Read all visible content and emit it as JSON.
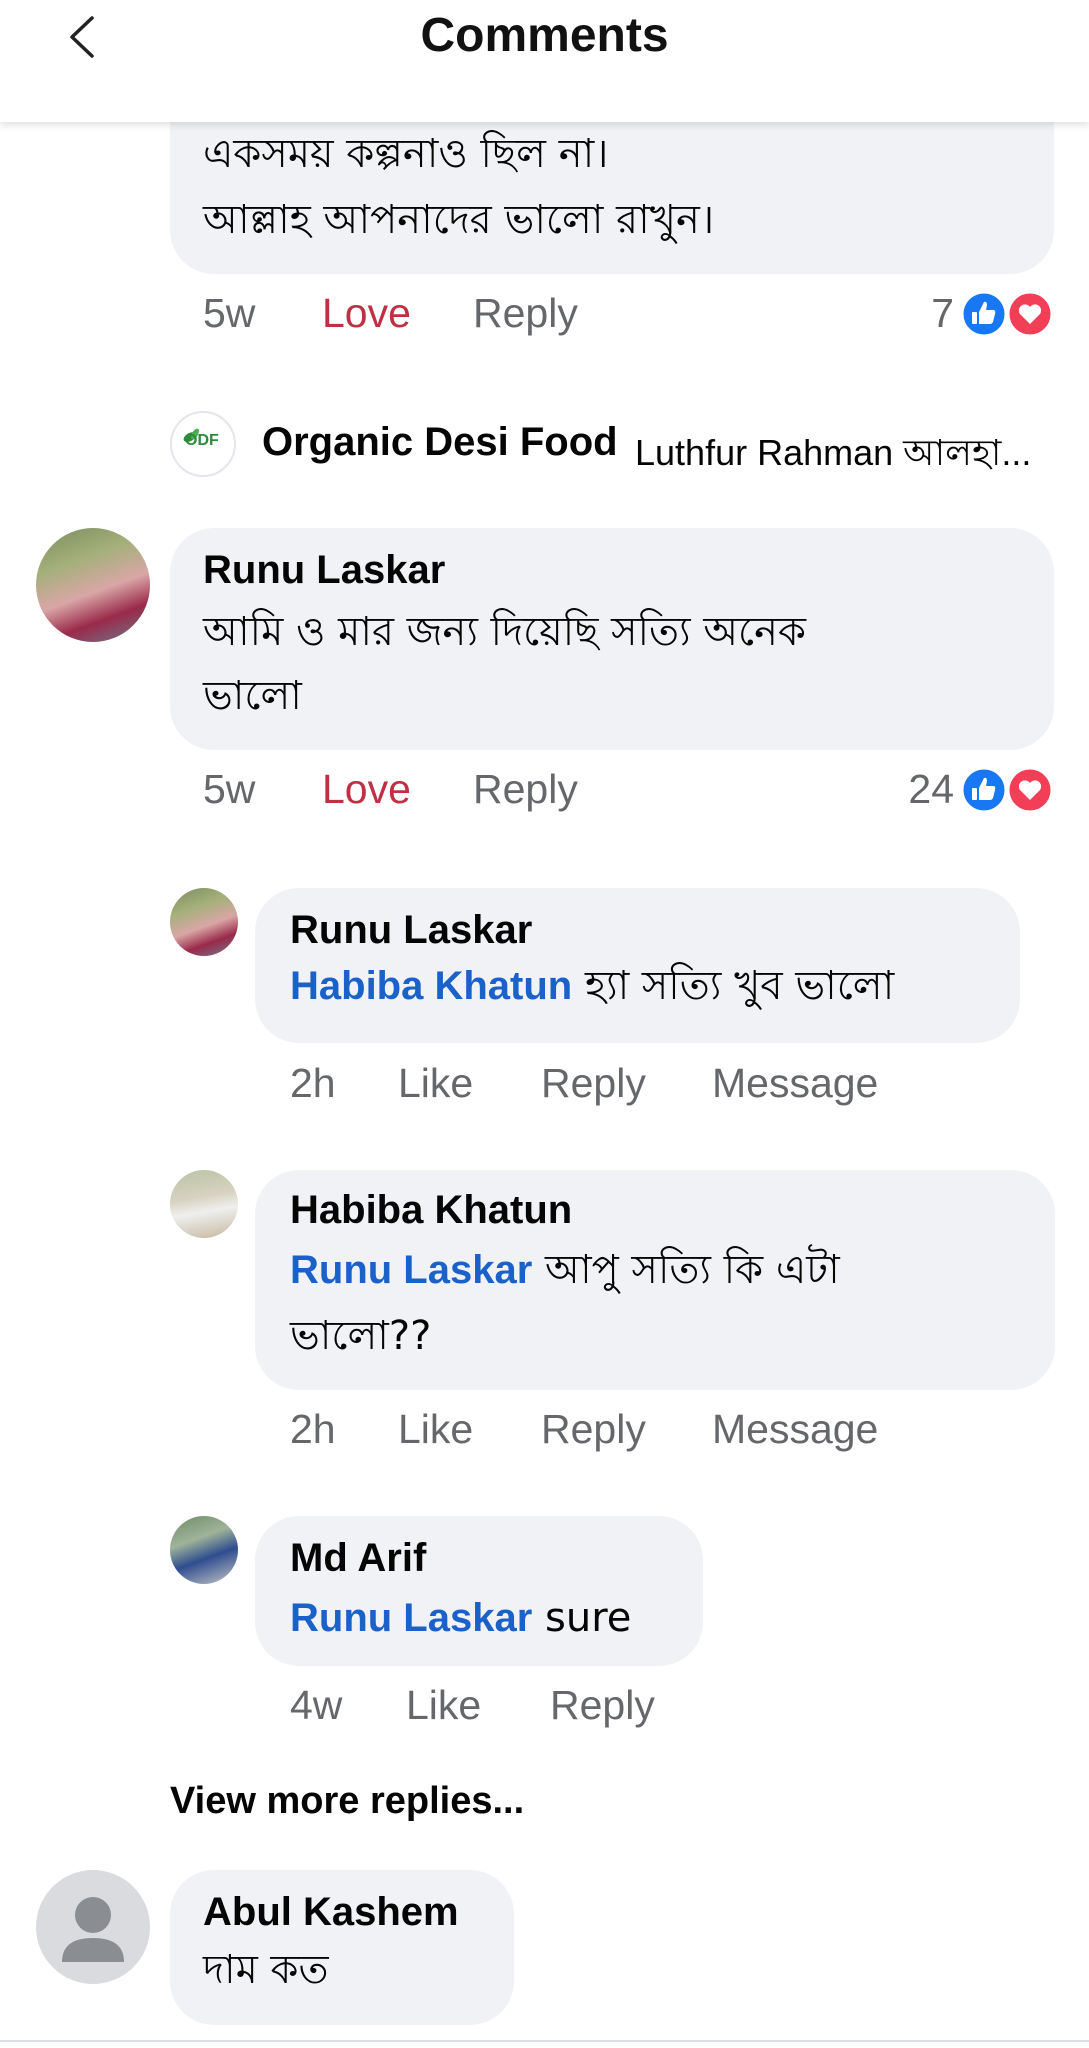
{
  "header": {
    "title": "Comments",
    "back_icon": "chevron-left-icon"
  },
  "colors": {
    "mention": "#1a62c9",
    "love": "#c12f45",
    "meta": "#65676b",
    "bubble": "#f0f2f5",
    "like_blue": "#1877f2",
    "love_red": "#f33e58"
  },
  "comment_top": {
    "lines": [
      "একসময় কল্পনাও ছিল না।",
      "আল্লাহ আপনাদের ভালো রাখুন।"
    ],
    "time": "5w",
    "reaction_label": "Love",
    "reply_label": "Reply",
    "reaction_count": "7",
    "reaction_icons": [
      "like-icon",
      "love-icon"
    ]
  },
  "page_reply": {
    "page_name": "Organic Desi Food",
    "logo_text": "ODF",
    "preview": "Luthfur Rahman আলহা..."
  },
  "comment_main": {
    "author": "Runu Laskar",
    "lines": [
      "আমি  ও মার জন্য  দিয়েছি সত্যি  অনেক",
      "ভালো"
    ],
    "time": "5w",
    "reaction_label": "Love",
    "reply_label": "Reply",
    "reaction_count": "24"
  },
  "replies": [
    {
      "author": "Runu Laskar",
      "mention": "Habiba Khatun",
      "text": " হ্যা সত্যি  খুব ভালো",
      "time": "2h",
      "like_label": "Like",
      "reply_label": "Reply",
      "message_label": "Message"
    },
    {
      "author": "Habiba Khatun",
      "mention": "Runu Laskar",
      "text": " আপু সত্যি কি এটা",
      "text2": "ভালো??",
      "time": "2h",
      "like_label": "Like",
      "reply_label": "Reply",
      "message_label": "Message"
    },
    {
      "author": "Md Arif",
      "mention": "Runu Laskar",
      "text": " sure",
      "time": "4w",
      "like_label": "Like",
      "reply_label": "Reply"
    }
  ],
  "view_more": "View more replies...",
  "comment_last": {
    "author": "Abul Kashem",
    "text": "দাম কত"
  }
}
